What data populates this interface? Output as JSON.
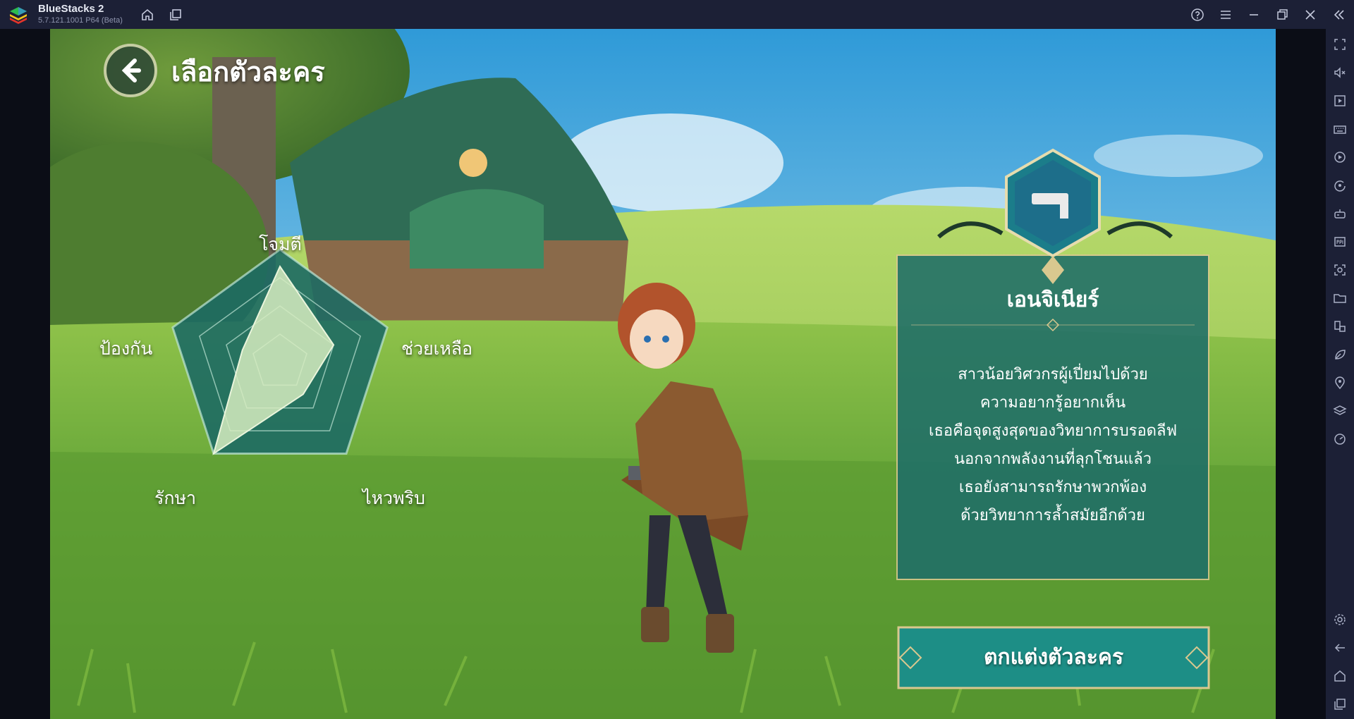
{
  "window": {
    "app_name": "BlueStacks 2",
    "version": "5.7.121.1001  P64 (Beta)"
  },
  "titlebar_icons": [
    "home-icon",
    "multi-instance-icon",
    "help-icon",
    "menu-icon",
    "minimize-icon",
    "restore-icon",
    "close-icon",
    "collapse-sidebar-icon"
  ],
  "sidebar_icons": [
    "fullscreen-icon",
    "volume-icon",
    "media-icon",
    "keyboard-icon",
    "macro-icon",
    "rotate-icon",
    "gamepad-icon",
    "apk-icon",
    "screenshot-icon",
    "folder-icon",
    "multi-instance-manager-icon",
    "eco-mode-icon",
    "location-icon",
    "layers-icon",
    "performance-icon",
    "settings-icon",
    "back-icon",
    "home-icon",
    "recent-apps-icon"
  ],
  "game": {
    "screen_title": "เลือกตัวละคร",
    "stats": {
      "attack": "โจมตี",
      "support": "ช่วยเหลือ",
      "agility": "ไหวพริบ",
      "heal": "รักษา",
      "defense": "ป้องกัน"
    },
    "stat_values": {
      "attack": 0.85,
      "support": 0.5,
      "agility": 0.35,
      "heal": 1.0,
      "defense": 0.35
    },
    "class_name": "เอนจิเนียร์",
    "class_icon": "gun-icon",
    "description_lines": [
      "สาวน้อยวิศวกรผู้เปี่ยมไปด้วย",
      "ความอยากรู้อยากเห็น",
      "เธอคือจุดสูงสุดของวิทยาการบรอดลีฟ",
      "นอกจากพลังงานที่ลุกโชนแล้ว",
      "เธอยังสามารถรักษาพวกพ้อง",
      "ด้วยวิทยาการล้ำสมัยอีกด้วย"
    ],
    "customize_button": "ตกแต่งตัวละคร"
  },
  "colors": {
    "chrome": "#1c2036",
    "panel": "#1f6e68",
    "accent_gold": "#d9c88f",
    "button": "#1d8e86"
  }
}
